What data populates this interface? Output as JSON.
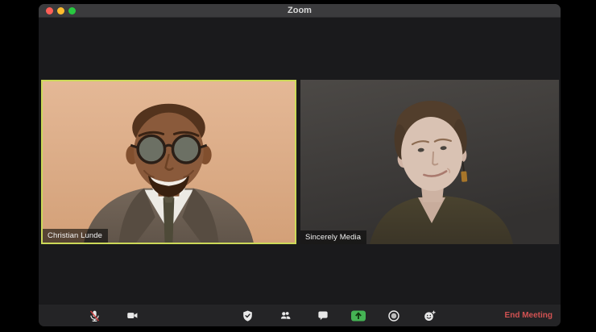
{
  "window": {
    "title": "Zoom"
  },
  "participants": [
    {
      "name": "Christian Lunde",
      "active_speaker": true
    },
    {
      "name": "Sincerely Media",
      "active_speaker": false
    }
  ],
  "toolbar": {
    "buttons": [
      {
        "id": "mute",
        "icon": "microphone-muted-icon",
        "state": "muted"
      },
      {
        "id": "stop-video",
        "icon": "video-camera-icon",
        "state": "on"
      },
      {
        "id": "security",
        "icon": "shield-icon"
      },
      {
        "id": "participants",
        "icon": "participants-icon"
      },
      {
        "id": "chat",
        "icon": "chat-bubble-icon"
      },
      {
        "id": "share-screen",
        "icon": "share-screen-icon"
      },
      {
        "id": "record",
        "icon": "record-icon"
      },
      {
        "id": "reactions",
        "icon": "reactions-smiley-icon"
      }
    ],
    "end_meeting_label": "End Meeting"
  },
  "colors": {
    "active_speaker_border": "#ccd958",
    "share_button_green": "#45b354",
    "end_meeting_red": "#d15252",
    "traffic_red": "#ff5f57",
    "traffic_yellow": "#febc2e",
    "traffic_green": "#28c840",
    "titlebar": "#3b3b3d",
    "window_background": "#1a1a1c",
    "toolbar_background": "#242426"
  }
}
